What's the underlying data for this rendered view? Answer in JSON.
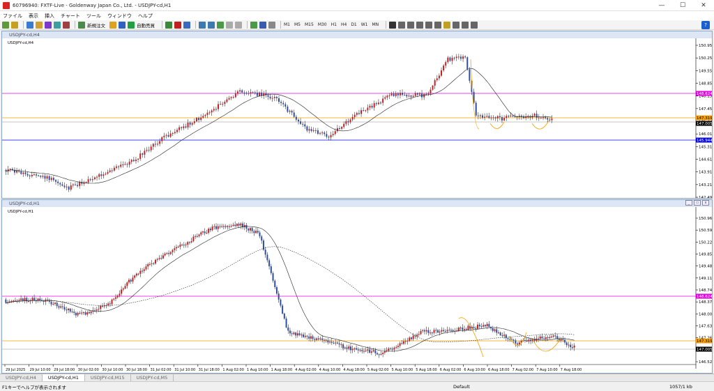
{
  "app": {
    "title": "60796940: FXTF-Live - Goldenway Japan Co., Ltd. - USDJPY-cd,H1",
    "menu": [
      "ファイル",
      "表示",
      "挿入",
      "チャート",
      "ツール",
      "ウィンドウ",
      "ヘルプ"
    ],
    "toolbar": {
      "new_order": "新規注文",
      "auto_trade": "自動売買",
      "timeframes": [
        "M1",
        "M5",
        "M15",
        "M30",
        "H1",
        "H4",
        "D1",
        "W1",
        "MN"
      ]
    },
    "help_icon": "?"
  },
  "colors": {
    "bull": "#c81e1e",
    "bear": "#2d4ea3",
    "magenta_line": "#e000e0",
    "orange_line": "#f5a000",
    "blue_line": "#0000e0",
    "gray_line": "#b0b0b0",
    "ma": "#222222"
  },
  "windows": [
    {
      "title": "USDJPY-cd,H4",
      "label": "USDJPY-cd,H4",
      "price_labels": [
        "150.950",
        "150.250",
        "149.550",
        "148.850",
        "148.150",
        "147.450",
        "146.730",
        "146.010",
        "145.310",
        "144.610",
        "143.910",
        "143.210",
        "142.490"
      ],
      "tag_labels": [
        "148.624",
        "147.319",
        "147.005",
        "145.944"
      ]
    },
    {
      "title": "USDJPY-cd,H1",
      "label": "USDJPY-cd,H1",
      "price_labels": [
        "150.960",
        "150.590",
        "150.220",
        "149.850",
        "149.480",
        "149.110",
        "148.740",
        "148.370",
        "148.000",
        "147.630",
        "147.260",
        "146.890",
        "146.520"
      ],
      "tag_labels": [
        "148.624",
        "147.319",
        "147.005"
      ],
      "time_labels": [
        "29 Jul 2025",
        "29 Jul 10:00",
        "29 Jul 18:00",
        "30 Jul 02:00",
        "30 Jul 10:00",
        "30 Jul 18:00",
        "31 Jul 02:00",
        "31 Jul 10:00",
        "31 Jul 18:00",
        "1 Aug 02:00",
        "1 Aug 10:00",
        "1 Aug 18:00",
        "4 Aug 02:00",
        "4 Aug 10:00",
        "4 Aug 18:00",
        "5 Aug 02:00",
        "5 Aug 10:00",
        "5 Aug 18:00",
        "6 Aug 02:00",
        "6 Aug 10:00",
        "6 Aug 18:00",
        "7 Aug 02:00",
        "7 Aug 10:00",
        "7 Aug 18:00"
      ]
    }
  ],
  "tabs": [
    "USDJPY-cd,H4",
    "USDJPY-cd,H1",
    "USDJPY-cd,M15",
    "USDJPY-cd,M5"
  ],
  "status": {
    "help": "F1キーでヘルプが表示されます",
    "profile": "Default",
    "connection": "1057/1 kb"
  }
}
